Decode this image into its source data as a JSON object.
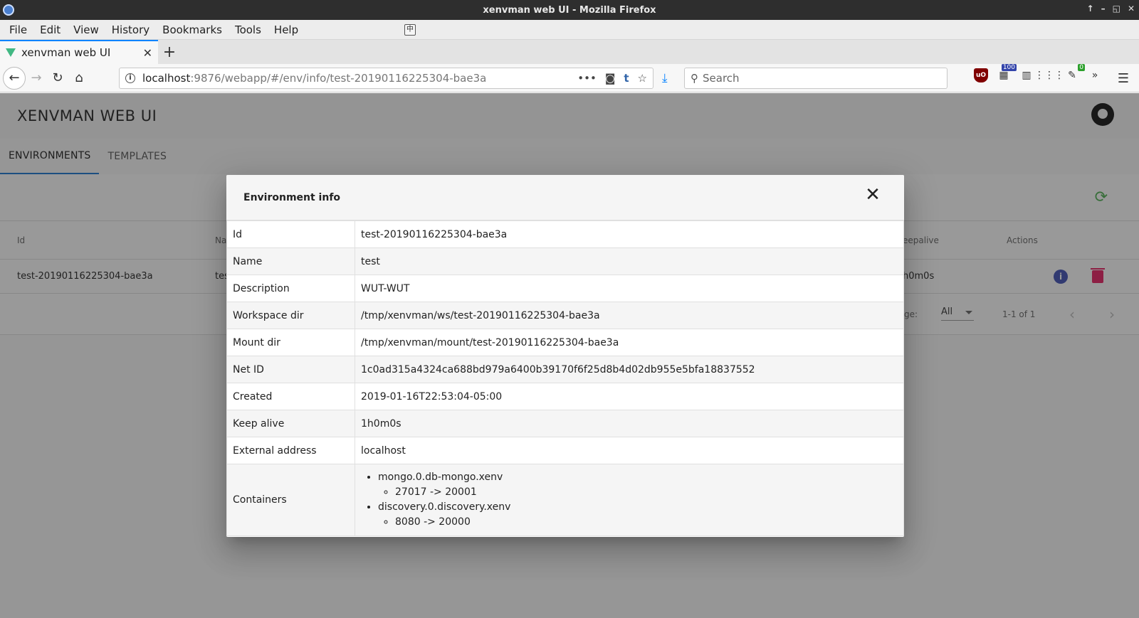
{
  "window": {
    "title": "xenvman web UI - Mozilla Firefox"
  },
  "menu": [
    "File",
    "Edit",
    "View",
    "History",
    "Bookmarks",
    "Tools",
    "Help"
  ],
  "browser_tab": {
    "title": "xenvman web UI",
    "close": "✕",
    "new": "+"
  },
  "urlbar": {
    "host": "localhost",
    "path": ":9876/webapp/#/env/info/test-20190116225304-bae3a"
  },
  "search": {
    "placeholder": "Search"
  },
  "extensions": {
    "counter_badge": "100",
    "green_badge": "0"
  },
  "app": {
    "title": "XENVMAN WEB UI",
    "tabs": [
      "ENVIRONMENTS",
      "TEMPLATES"
    ]
  },
  "table": {
    "headers": {
      "id": "Id",
      "name": "Na",
      "keepalive": "eepalive",
      "actions": "Actions"
    },
    "row": {
      "id": "test-20190116225304-bae3a",
      "name": "tes",
      "keepalive": "h0m0s"
    },
    "footer": {
      "rows_per_page_label": "ge:",
      "rows_per_page": "All",
      "range": "1-1 of 1"
    }
  },
  "dialog": {
    "title": "Environment info",
    "rows": [
      {
        "key": "Id",
        "value": "test-20190116225304-bae3a"
      },
      {
        "key": "Name",
        "value": "test"
      },
      {
        "key": "Description",
        "value": "WUT-WUT"
      },
      {
        "key": "Workspace dir",
        "value": "/tmp/xenvman/ws/test-20190116225304-bae3a"
      },
      {
        "key": "Mount dir",
        "value": "/tmp/xenvman/mount/test-20190116225304-bae3a"
      },
      {
        "key": "Net ID",
        "value": "1c0ad315a4324ca688bd979a6400b39170f6f25d8b4d02db955e5bfa18837552"
      },
      {
        "key": "Created",
        "value": "2019-01-16T22:53:04-05:00"
      },
      {
        "key": "Keep alive",
        "value": "1h0m0s"
      },
      {
        "key": "External address",
        "value": "localhost"
      }
    ],
    "containers": {
      "key": "Containers",
      "items": [
        {
          "name": "mongo.0.db-mongo.xenv",
          "ports": [
            "27017 -> 20001"
          ]
        },
        {
          "name": "discovery.0.discovery.xenv",
          "ports": [
            "8080 -> 20000"
          ]
        }
      ]
    }
  },
  "colors": {
    "accent": "#1976d2",
    "info_icon": "#3f51b5",
    "delete_icon": "#e91e63",
    "refresh_icon": "#4caf50"
  }
}
